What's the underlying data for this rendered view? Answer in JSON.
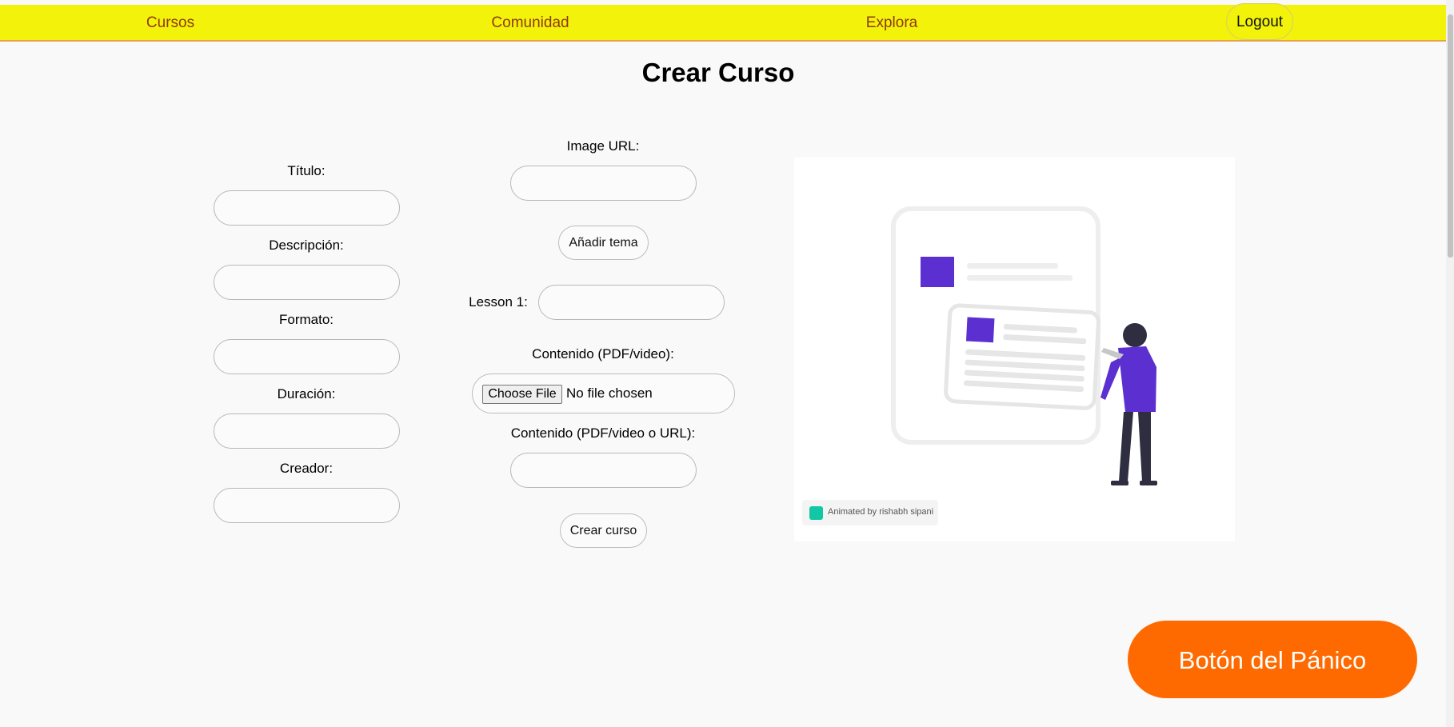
{
  "nav": {
    "links": [
      "Cursos",
      "Comunidad",
      "Explora"
    ],
    "logout_label": "Logout"
  },
  "page_title": "Crear Curso",
  "form_left": {
    "titulo_label": "Título:",
    "descripcion_label": "Descripción:",
    "formato_label": "Formato:",
    "duracion_label": "Duración:",
    "creador_label": "Creador:"
  },
  "form_middle": {
    "image_url_label": "Image URL:",
    "add_topic_label": "Añadir tema",
    "lesson_label": "Lesson 1:",
    "content_file_label": "Contenido (PDF/video):",
    "choose_file_label": "Choose File",
    "file_status": "No file chosen",
    "content_url_label": "Contenido (PDF/video o URL):",
    "submit_label": "Crear curso"
  },
  "illustration": {
    "credit": "Animated by rishabh sipani"
  },
  "panic_button_label": "Botón del Pánico",
  "colors": {
    "navbar": "#f2f20a",
    "nav_link": "#8e3b0e",
    "panic": "#ff6a00",
    "illustration_accent": "#5b2fd0"
  }
}
